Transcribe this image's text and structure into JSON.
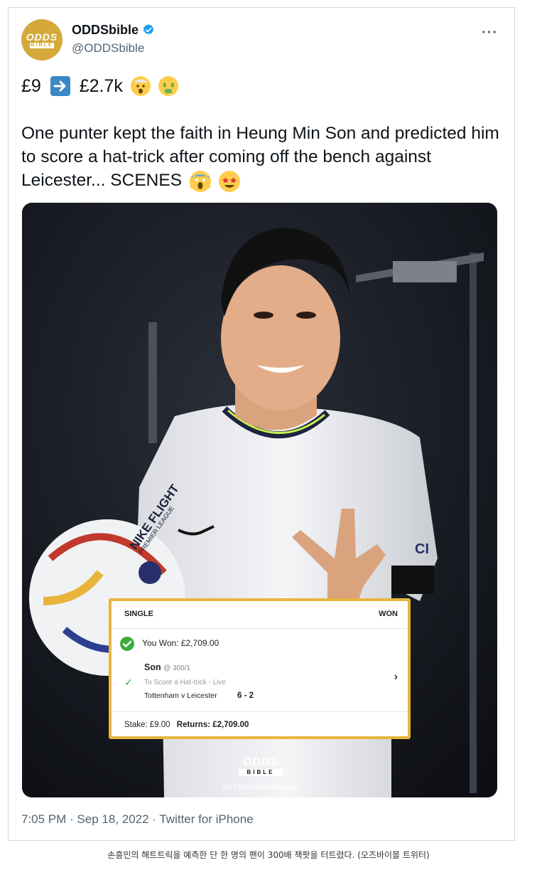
{
  "tweet": {
    "display_name": "ODDSbible",
    "handle": "@ODDSbible",
    "avatar_logo_top": "ODDS",
    "avatar_logo_bottom": "BIBLE",
    "line1_from": "£9",
    "line1_to": "£2.7k",
    "text": "One punter kept the faith in Heung Min Son and predicted him to score a hat-trick after coming off the bench against Leicester... SCENES",
    "timestamp": "7:05 PM · Sep 18, 2022 · Twitter for iPhone",
    "icons": [
      "verified-badge-icon",
      "more-options-icon",
      "right-arrow-icon",
      "exploding-head-emoji",
      "money-mouth-emoji",
      "screaming-face-emoji",
      "star-struck-emoji"
    ]
  },
  "bet_slip": {
    "type": "SINGLE",
    "status": "WON",
    "won_text": "You Won: £2,709.00",
    "selection": "Son",
    "odds": "@ 300/1",
    "market": "To Score a Hat-trick - Live",
    "match": "Tottenham v Leicester",
    "score": "6 - 2",
    "stake": "Stake: £9.00",
    "returns": "Returns: £2,709.00"
  },
  "media_branding": {
    "logo_top": "ODDS",
    "logo_bottom": "BIBLE",
    "gamble_aware": "18+ | BeGambleAware.org",
    "ball_text": "NIKE FLIGHT",
    "ball_subtext": "PREMIER LEAGUE",
    "shirt_text": "CI"
  },
  "caption": "손흥민의 해트트릭을 예측한 단 한 명의 팬이 300배 잭팟을 터트렸다. (오즈바이블 트위터)",
  "colors": {
    "accent_blue": "#1d9bf0",
    "gold": "#e7b53e",
    "win_green": "#3dab3d"
  }
}
